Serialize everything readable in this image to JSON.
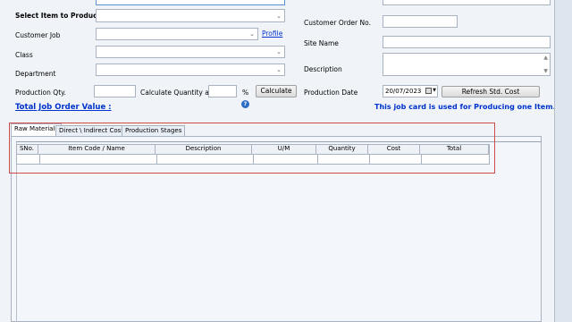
{
  "form": {
    "select_item_label": "Select Item to Produce",
    "customer_job_label": "Customer Job",
    "profile_link": "Profile",
    "class_label": "Class",
    "department_label": "Department",
    "production_qty_label": "Production Qty.",
    "calc_qty_label": "Calculate Quantity as",
    "percent_symbol": "%",
    "calculate_button": "Calculate",
    "total_job_order_label": "Total Job Order Value :",
    "customer_order_no_label": "Customer Order No.",
    "site_name_label": "Site Name",
    "description_label": "Description",
    "production_date_label": "Production Date",
    "production_date_value": "20/07/2023",
    "refresh_button": "Refresh Std. Cost",
    "job_card_note": "This job card is used for Producing one Item."
  },
  "tabs": [
    "Raw Materials",
    "Direct \\ Indirect Cost",
    "Production Stages"
  ],
  "grid": {
    "columns": [
      "SNo.",
      "Item Code / Name",
      "Description",
      "U/M",
      "Quantity",
      "Cost",
      "Total"
    ]
  },
  "colors": {
    "highlight_border": "#d04a4a",
    "link_blue": "#0033cc",
    "background": "#f0f4f9"
  }
}
